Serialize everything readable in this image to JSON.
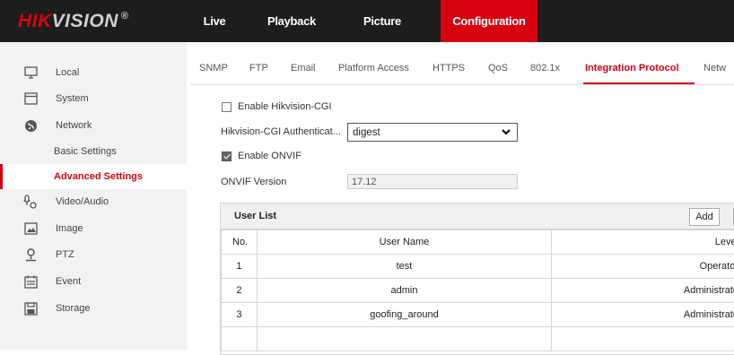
{
  "brand": {
    "name_red": "HIK",
    "name_rest": "VISION",
    "reg_mark": "®"
  },
  "top_nav": [
    {
      "label": "Live View",
      "active": false
    },
    {
      "label": "Playback",
      "active": false
    },
    {
      "label": "Picture",
      "active": false
    },
    {
      "label": "Configuration",
      "active": true
    }
  ],
  "sidebar": [
    {
      "label": "Local",
      "icon": "monitor-icon"
    },
    {
      "label": "System",
      "icon": "system-icon"
    },
    {
      "label": "Network",
      "icon": "globe-icon"
    },
    {
      "label": "Basic Settings",
      "sub": true
    },
    {
      "label": "Advanced Settings",
      "sub": true,
      "active": true
    },
    {
      "label": "Video/Audio",
      "icon": "video-audio-icon"
    },
    {
      "label": "Image",
      "icon": "image-icon"
    },
    {
      "label": "PTZ",
      "icon": "ptz-icon"
    },
    {
      "label": "Event",
      "icon": "event-icon"
    },
    {
      "label": "Storage",
      "icon": "storage-icon"
    }
  ],
  "tabs": [
    "SNMP",
    "FTP",
    "Email",
    "Platform Access",
    "HTTPS",
    "QoS",
    "802.1x",
    "Integration Protocol",
    "Netw"
  ],
  "active_tab": "Integration Protocol",
  "form": {
    "enable_cgi_label": "Enable Hikvision-CGI",
    "enable_cgi_checked": false,
    "auth_label": "Hikvision-CGI Authenticat...",
    "auth_value": "digest",
    "enable_onvif_label": "Enable ONVIF",
    "enable_onvif_checked": true,
    "onvif_version_label": "ONVIF Version",
    "onvif_version_value": "17.12"
  },
  "user_list": {
    "title": "User List",
    "add_label": "Add",
    "columns": [
      "No.",
      "User Name",
      "Level"
    ],
    "rows": [
      {
        "no": "1",
        "name": "test",
        "level": "Operator"
      },
      {
        "no": "2",
        "name": "admin",
        "level": "Administrato"
      },
      {
        "no": "3",
        "name": "goofing_around",
        "level": "Administrato"
      }
    ]
  },
  "colors": {
    "accent": "#d7000f",
    "topbar": "#1d1d1d",
    "sidebar": "#f2f2f2"
  }
}
